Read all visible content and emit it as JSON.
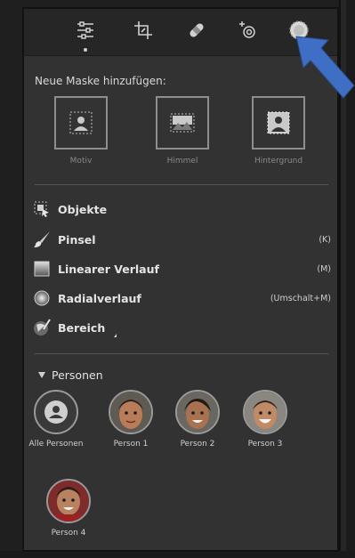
{
  "toolbar": {
    "tools": [
      {
        "name": "edit-sliders-icon"
      },
      {
        "name": "crop-icon"
      },
      {
        "name": "healing-bandage-icon"
      },
      {
        "name": "red-eye-icon"
      },
      {
        "name": "masking-icon"
      }
    ],
    "active_index": 0
  },
  "add_mask": {
    "title": "Neue Maske hinzufügen:",
    "buttons": [
      {
        "label": "Motiv",
        "icon": "subject-icon"
      },
      {
        "label": "Himmel",
        "icon": "sky-icon"
      },
      {
        "label": "Hintergrund",
        "icon": "background-icon"
      }
    ]
  },
  "menu": {
    "items": [
      {
        "label": "Objekte",
        "shortcut": "",
        "icon": "objects-icon"
      },
      {
        "label": "Pinsel",
        "shortcut": "(K)",
        "icon": "brush-icon"
      },
      {
        "label": "Linearer Verlauf",
        "shortcut": "(M)",
        "icon": "linear-gradient-icon"
      },
      {
        "label": "Radialverlauf",
        "shortcut": "(Umschalt+M)",
        "icon": "radial-gradient-icon"
      },
      {
        "label": "Bereich",
        "shortcut": "",
        "icon": "range-icon"
      }
    ]
  },
  "persons": {
    "title": "Personen",
    "items": [
      {
        "label": "Alle Personen"
      },
      {
        "label": "Person 1"
      },
      {
        "label": "Person 2"
      },
      {
        "label": "Person 3"
      },
      {
        "label": "Person 4"
      }
    ]
  },
  "colors": {
    "panel": "#323232",
    "toolbar": "#262626",
    "arrow": "#3f6fc4"
  }
}
